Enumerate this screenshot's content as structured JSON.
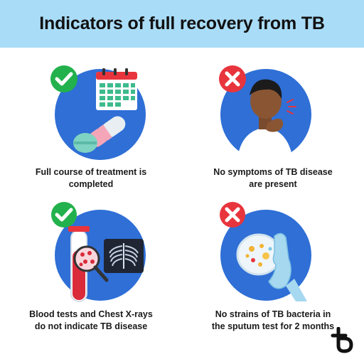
{
  "header": {
    "title": "Indicators of full recovery from TB"
  },
  "colors": {
    "header_bg": "#a9dcf7",
    "circle": "#2f6fd6",
    "check": "#22b14c",
    "cross": "#e8353d"
  },
  "cards": [
    {
      "status_icon": "check-icon",
      "caption_line1": "Full course of treatment is",
      "caption_line2": "completed"
    },
    {
      "status_icon": "cross-icon",
      "caption_line1": "No symptoms of TB disease",
      "caption_line2": "are present"
    },
    {
      "status_icon": "check-icon",
      "caption_line1": "Blood tests and Chest X-rays",
      "caption_line2": "do not indicate TB disease"
    },
    {
      "status_icon": "cross-icon",
      "caption_line1": "No strains of TB bacteria in",
      "caption_line2": "the sputum test for 2 months"
    }
  ],
  "brand": {
    "logo_icon": "tb-logo-icon"
  }
}
